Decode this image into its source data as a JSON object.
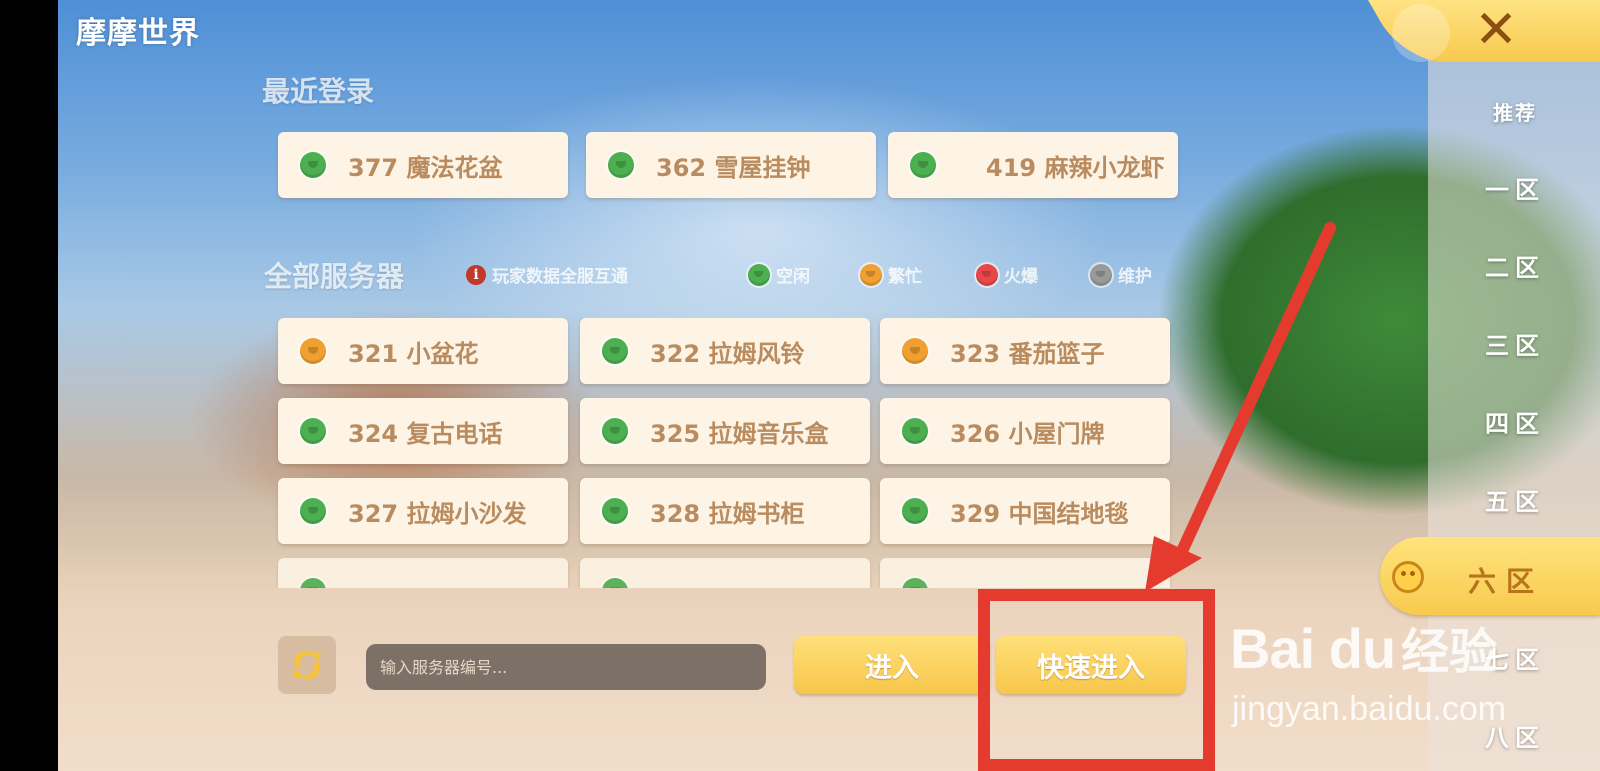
{
  "app": {
    "logo_text": "摩摩世界"
  },
  "recent": {
    "title": "最近登录",
    "servers": [
      {
        "label": "377 魔法花盆",
        "status": "idle"
      },
      {
        "label": "362 雪屋挂钟",
        "status": "idle"
      },
      {
        "label": "419 麻辣小龙虾",
        "status": "idle"
      }
    ]
  },
  "all_servers": {
    "title": "全部服务器",
    "info_note": "玩家数据全服互通",
    "legend": [
      {
        "label": "空闲",
        "status": "idle"
      },
      {
        "label": "繁忙",
        "status": "busy"
      },
      {
        "label": "火爆",
        "status": "hot"
      },
      {
        "label": "维护",
        "status": "maintenance"
      }
    ],
    "servers": [
      {
        "label": "321 小盆花",
        "status": "busy"
      },
      {
        "label": "322 拉姆风铃",
        "status": "idle"
      },
      {
        "label": "323 番茄篮子",
        "status": "busy"
      },
      {
        "label": "324 复古电话",
        "status": "idle"
      },
      {
        "label": "325 拉姆音乐盒",
        "status": "idle"
      },
      {
        "label": "326 小屋门牌",
        "status": "idle"
      },
      {
        "label": "327 拉姆小沙发",
        "status": "idle"
      },
      {
        "label": "328 拉姆书柜",
        "status": "idle"
      },
      {
        "label": "329 中国结地毯",
        "status": "idle"
      }
    ]
  },
  "status_colors": {
    "idle": "#4caf50",
    "busy": "#f0a030",
    "hot": "#e84848",
    "maintenance": "#9a9a9a"
  },
  "bottom": {
    "input_placeholder": "输入服务器编号...",
    "enter_label": "进入",
    "quick_enter_label": "快速进入"
  },
  "sidebar": {
    "items": [
      {
        "label": "推荐",
        "active": false
      },
      {
        "label": "一区",
        "active": false
      },
      {
        "label": "二区",
        "active": false
      },
      {
        "label": "三区",
        "active": false
      },
      {
        "label": "四区",
        "active": false
      },
      {
        "label": "五区",
        "active": false
      },
      {
        "label": "六区",
        "active": true
      },
      {
        "label": "七区",
        "active": false
      },
      {
        "label": "八区",
        "active": false
      }
    ]
  },
  "watermark": {
    "logo": "Bai du",
    "suffix": "经验",
    "url": "jingyan.baidu.com"
  }
}
